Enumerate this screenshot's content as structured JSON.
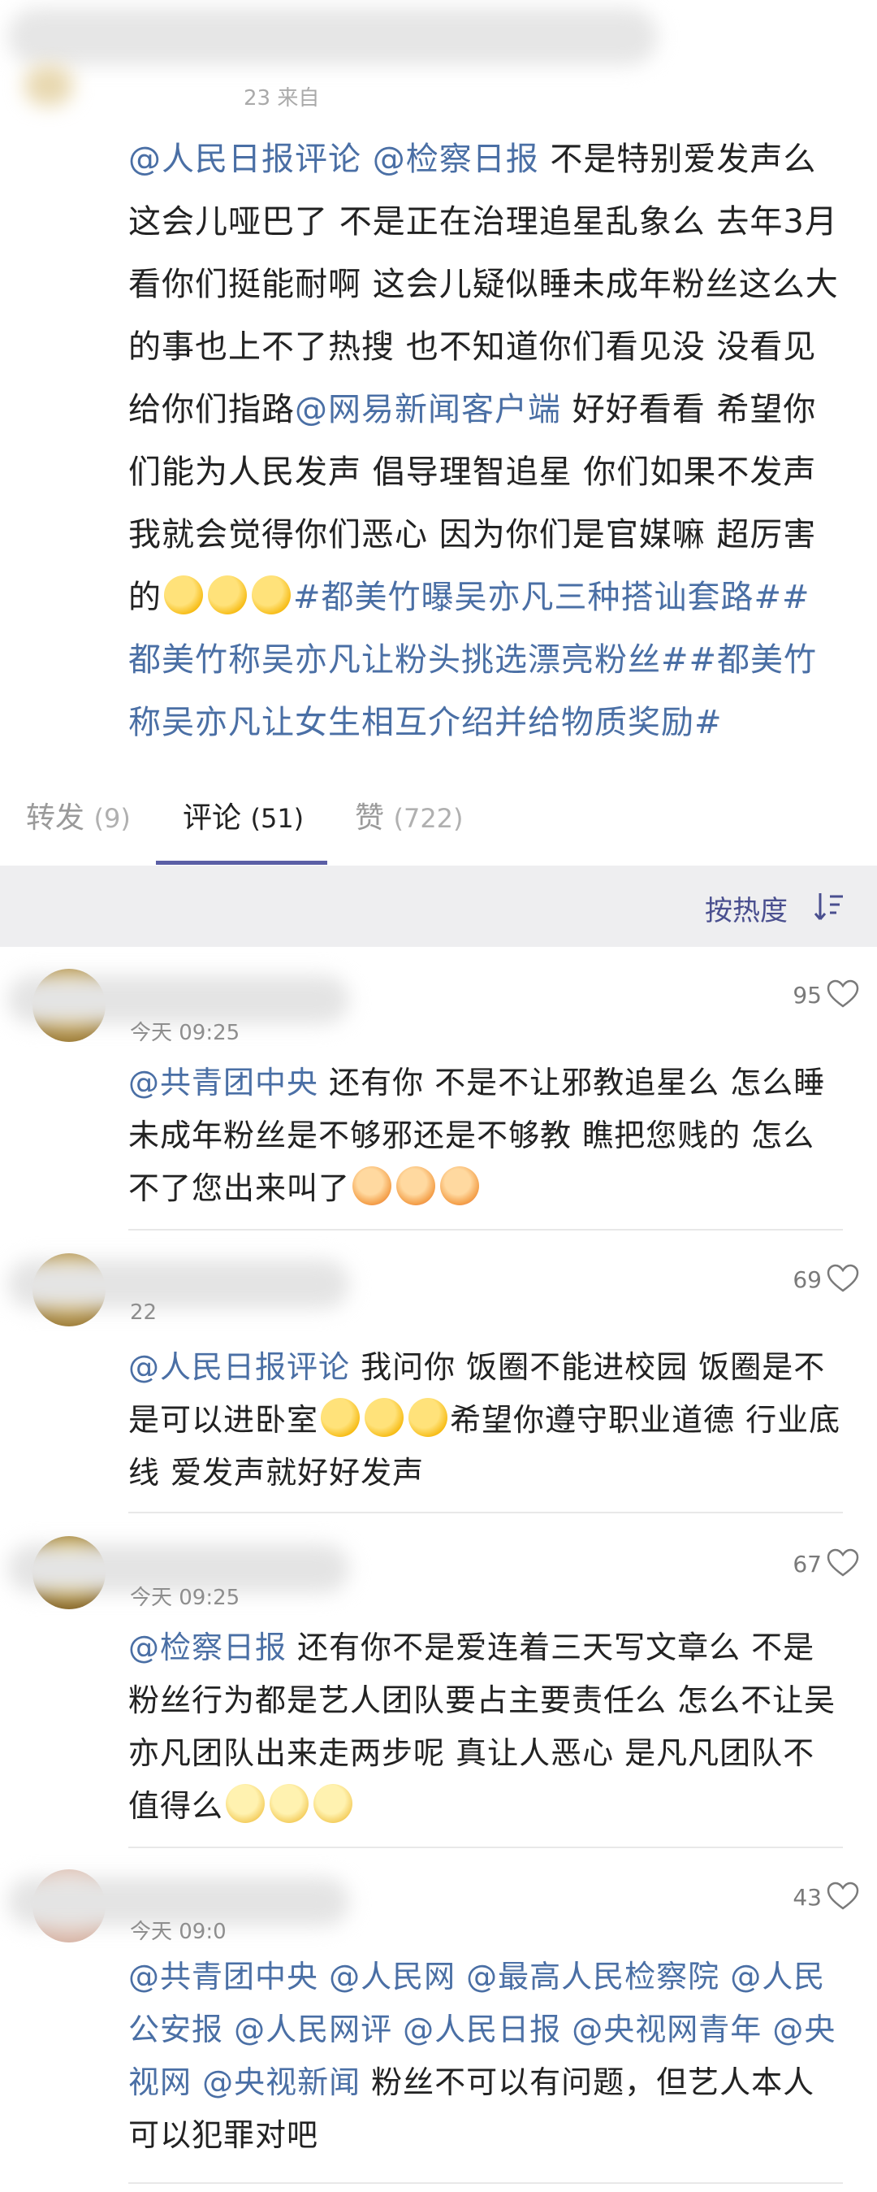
{
  "post": {
    "time_partial": "23 来自",
    "text_segments": [
      {
        "text": "@人民日报评论",
        "link": true
      },
      {
        "text": " ",
        "link": false
      },
      {
        "text": "@检察日报",
        "link": true
      },
      {
        "text": " 不是特别爱发声么 这会儿哑巴了 不是正在治理追星乱象么 去年3月看你们挺能耐啊 这会儿疑似睡未成年粉丝这么大的事也上不了热搜 也不知道你们看见没 没看见给你们指路",
        "link": false
      },
      {
        "text": "@网易新闻客户端",
        "link": true
      },
      {
        "text": " 好好看看 希望你们能为人民发声 倡导理智追星 你们如果不发声 我就会觉得你们恶心 因为你们是官媒嘛 超厉害的",
        "link": false
      },
      {
        "emoji": "hug"
      },
      {
        "emoji": "hug"
      },
      {
        "emoji": "hug"
      },
      {
        "text": "#都美竹曝吴亦凡三种搭讪套路##都美竹称吴亦凡让粉头挑选漂亮粉丝##都美竹称吴亦凡让女生相互介绍并给物质奖励#",
        "link": true
      }
    ]
  },
  "tabs": [
    {
      "label": "转发",
      "count": "(9)"
    },
    {
      "label": "评论",
      "count": "(51)"
    },
    {
      "label": "赞",
      "count": "(722)"
    }
  ],
  "sort": {
    "label": "按热度"
  },
  "comments": [
    {
      "time": "今天 09:25",
      "likes": "95",
      "segments": [
        {
          "text": "@共青团中央",
          "link": true
        },
        {
          "text": " 还有你 不是不让邪教追星么 怎么睡未成年粉丝是不够邪还是不够教 瞧把您贱的 怎么不了您出来叫了",
          "link": false
        },
        {
          "emoji": "vomit"
        },
        {
          "emoji": "vomit"
        },
        {
          "emoji": "vomit"
        }
      ]
    },
    {
      "time": "22",
      "likes": "69",
      "segments": [
        {
          "text": "@人民日报评论",
          "link": true
        },
        {
          "text": " 我问你 饭圈不能进校园 饭圈是不是可以进卧室",
          "link": false
        },
        {
          "emoji": "hug"
        },
        {
          "emoji": "hug"
        },
        {
          "emoji": "hug"
        },
        {
          "text": "希望你遵守职业道德 行业底线 爱发声就好好发声",
          "link": false
        }
      ]
    },
    {
      "time": "今天 09:25",
      "likes": "67",
      "segments": [
        {
          "text": "@检察日报",
          "link": true
        },
        {
          "text": " 还有你不是爱连着三天写文章么 不是粉丝行为都是艺人团队要占主要责任么 怎么不让吴亦凡团队出来走两步呢 真让人恶心 是凡凡团队不值得么",
          "link": false
        },
        {
          "emoji": "sad"
        },
        {
          "emoji": "sad"
        },
        {
          "emoji": "sad"
        }
      ]
    },
    {
      "time": "今天 09:0",
      "likes": "43",
      "segments": [
        {
          "text": "@共青团中央 @人民网 @最高人民检察院 @人民公安报 @人民网评 @人民日报 @央视网青年 @央视网 @央视新闻",
          "link": true
        },
        {
          "text": " 粉丝不可以有问题，但艺人本人可以犯罪对吧",
          "link": false
        }
      ]
    }
  ]
}
